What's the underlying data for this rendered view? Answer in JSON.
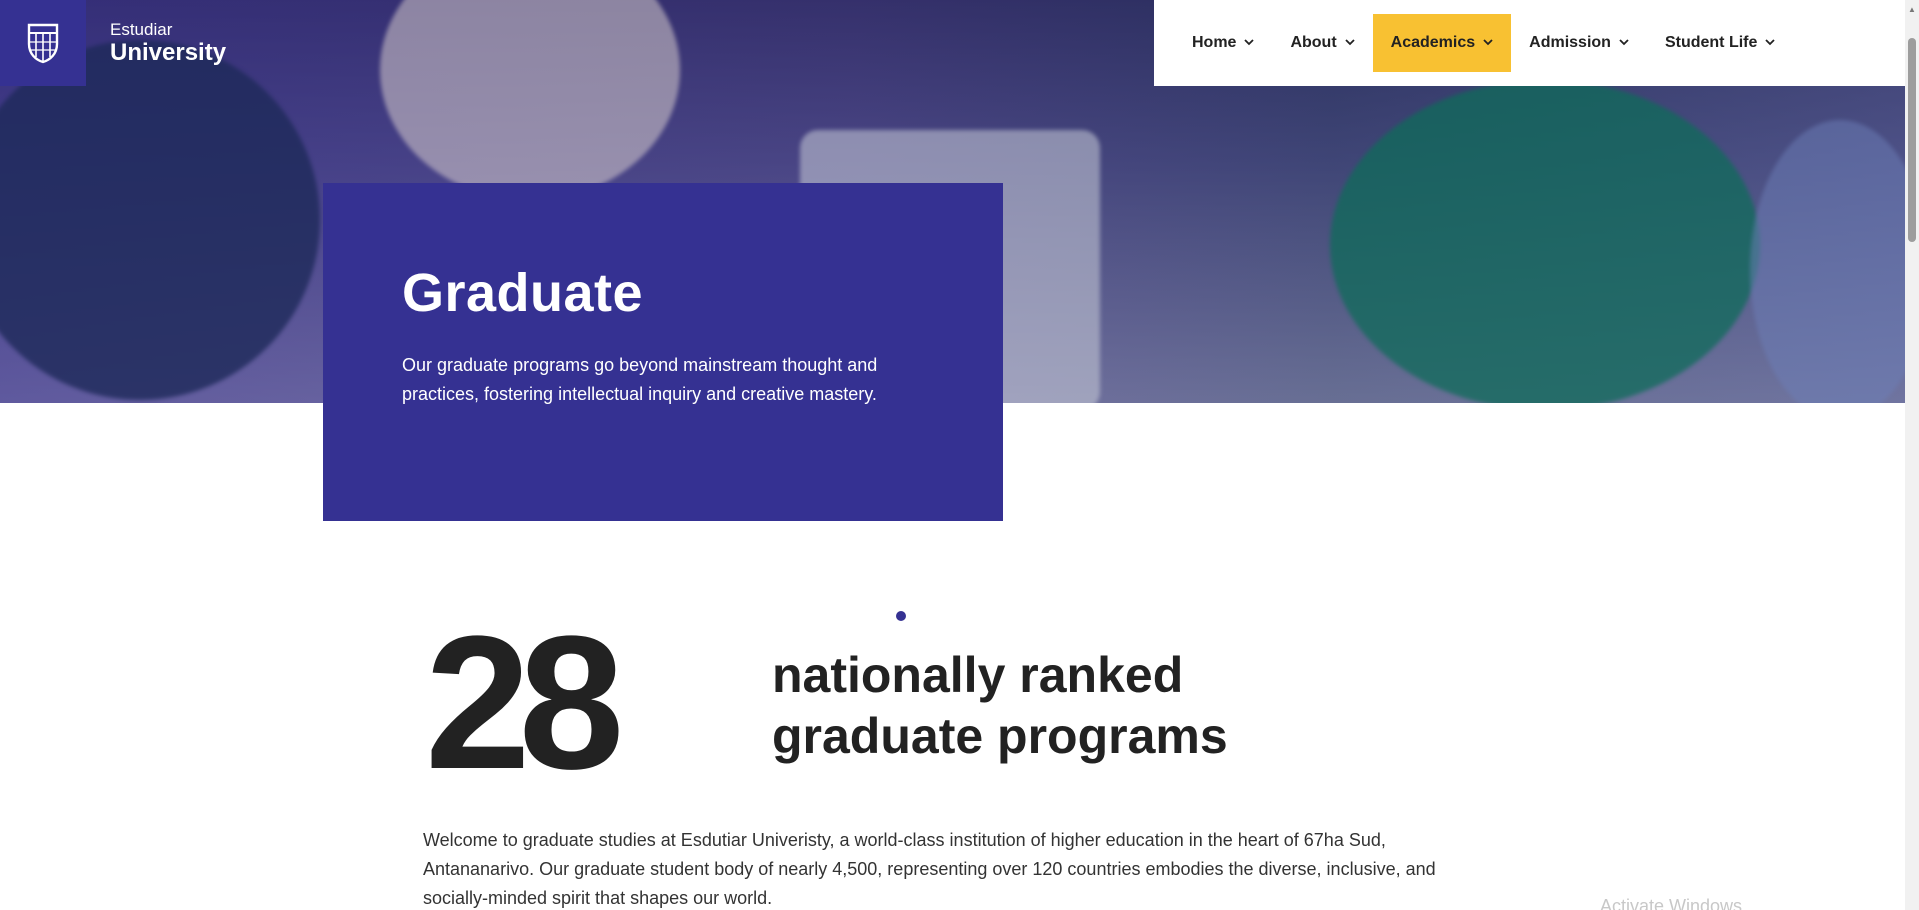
{
  "brand": {
    "name_small": "Estudiar",
    "name_big": "University",
    "logo_icon": "shield-logo-icon",
    "primary_color": "#353192",
    "accent_color": "#f8c132"
  },
  "nav": {
    "items": [
      {
        "label": "Home",
        "active": false
      },
      {
        "label": "About",
        "active": false
      },
      {
        "label": "Academics",
        "active": true
      },
      {
        "label": "Admission",
        "active": false
      },
      {
        "label": "Student Life",
        "active": false
      }
    ]
  },
  "hero": {
    "title": "Graduate",
    "description": "Our graduate programs go beyond mainstream thought and practices, fostering intellectual inquiry and creative mastery."
  },
  "stats": {
    "number": "28",
    "line1": "nationally ranked",
    "line2": "graduate programs"
  },
  "intro": {
    "text": "Welcome to graduate studies at Esdutiar Univeristy, a world-class institution of higher education in the heart of 67ha Sud, Antananarivo. Our graduate student body of nearly 4,500, representing over 120 countries embodies the diverse, inclusive, and socially-minded spirit that shapes our world."
  },
  "watermark": {
    "text": "Activate Windows"
  }
}
